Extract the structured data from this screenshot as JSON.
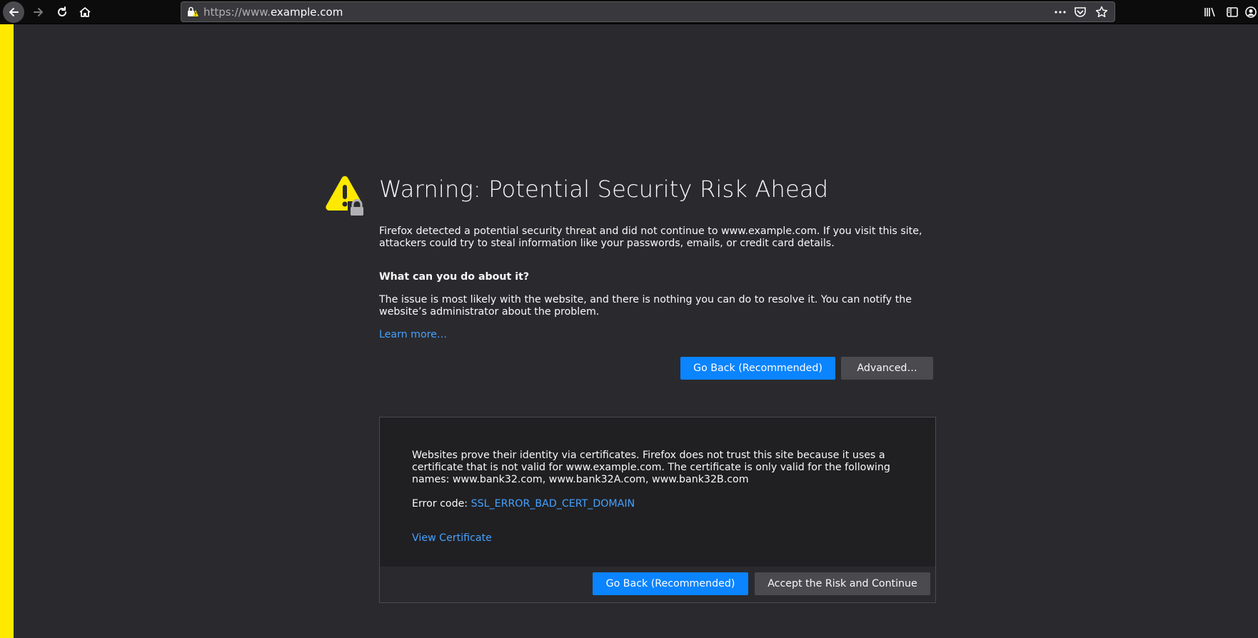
{
  "toolbar": {
    "url_prefix": "https://www.",
    "url_domain": "example.com",
    "icons": [
      "back-arrow-icon",
      "forward-arrow-icon",
      "reload-icon",
      "home-icon",
      "lock-warning-icon",
      "more-icon",
      "pocket-icon",
      "star-icon",
      "library-icon",
      "sidebar-icon",
      "account-icon"
    ]
  },
  "colors": {
    "accent": "#0a84ff",
    "link": "#45a1ff",
    "warning": "#ffe900",
    "background": "#2a2a2e"
  },
  "page": {
    "title": "Warning: Potential Security Risk Ahead",
    "intro": "Firefox detected a potential security threat and did not continue to www.example.com. If you visit this site, attackers could try to steal information like your passwords, emails, or credit card details.",
    "what_heading": "What can you do about it?",
    "issue": "The issue is most likely with the website, and there is nothing you can do to resolve it. You can notify the website’s administrator about the problem.",
    "learn_more": "Learn more…",
    "go_back_label": "Go Back (Recommended)",
    "advanced_label": "Advanced…"
  },
  "advanced": {
    "cert_text": "Websites prove their identity via certificates. Firefox does not trust this site because it uses a certificate that is not valid for www.example.com. The certificate is only valid for the following names: www.bank32.com, www.bank32A.com, www.bank32B.com",
    "error_label": "Error code: ",
    "error_code": "SSL_ERROR_BAD_CERT_DOMAIN",
    "view_certificate": "View Certificate",
    "go_back_label": "Go Back (Recommended)",
    "accept_label": "Accept the Risk and Continue"
  }
}
